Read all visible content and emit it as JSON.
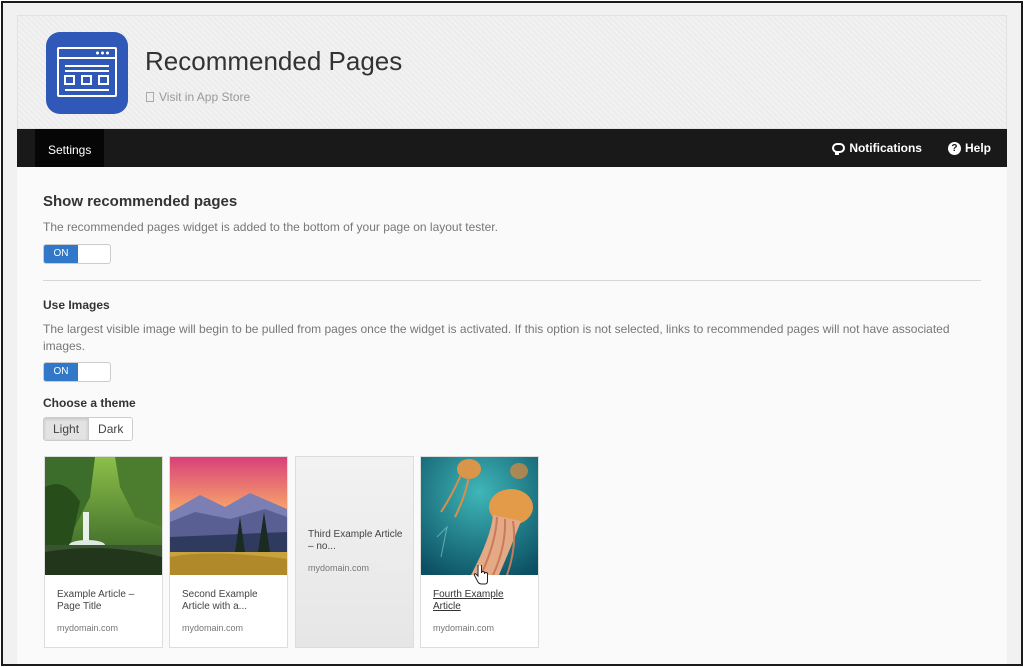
{
  "app": {
    "title": "Recommended Pages",
    "store_link": "Visit in App Store",
    "icon": "browser-window-icon",
    "accent_color": "#2f58b8"
  },
  "nav": {
    "active_tab": "Settings",
    "notifications": "Notifications",
    "help": "Help"
  },
  "section_show": {
    "title": "Show recommended pages",
    "description": "The recommended pages widget is added to the bottom of your page on layout tester.",
    "toggle_label": "ON"
  },
  "section_images": {
    "title": "Use Images",
    "description_line1": "The largest visible image will begin to be pulled from pages once the widget is activated. If this option is not selected, links to recommended pages will not have associated",
    "description_line2": "images.",
    "toggle_label": "ON"
  },
  "theme": {
    "title": "Choose a theme",
    "options": [
      "Light",
      "Dark"
    ],
    "selected": "Light"
  },
  "cards": [
    {
      "title": "Example Article – Page Title",
      "domain": "mydomain.com",
      "image": "waterfall"
    },
    {
      "title": "Second Example Article with a...",
      "domain": "mydomain.com",
      "image": "mountain-sunset"
    },
    {
      "title": "Third Example Article – no...",
      "domain": "mydomain.com",
      "image": "none"
    },
    {
      "title": "Fourth Example Article",
      "domain": "mydomain.com",
      "image": "jellyfish"
    }
  ]
}
